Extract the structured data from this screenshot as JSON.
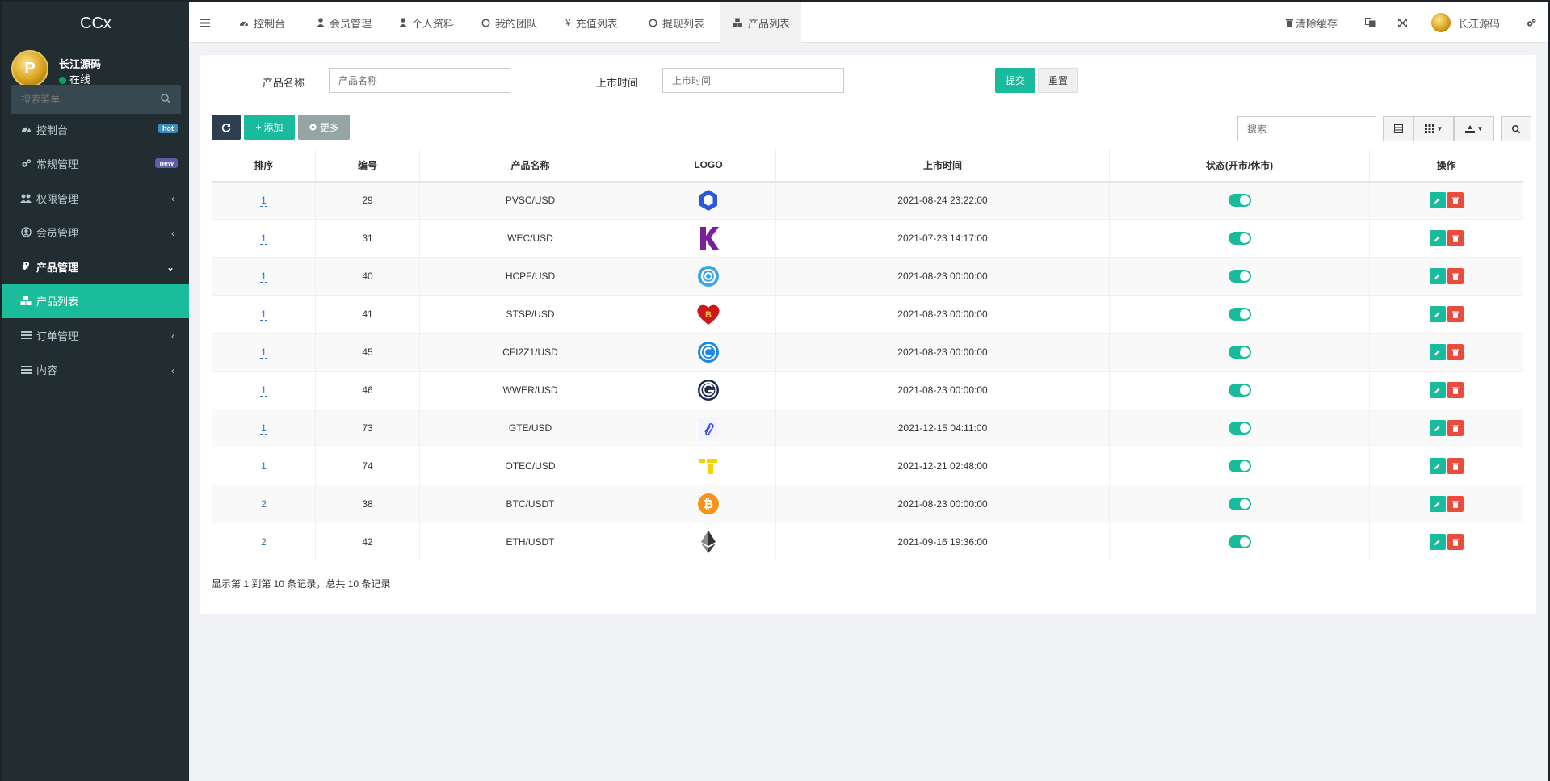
{
  "brand": "CCx",
  "user": {
    "name": "长江源码",
    "status": "在线",
    "avatar_letter": "P"
  },
  "sidebar": {
    "search_placeholder": "搜索菜单",
    "items": [
      {
        "label": "控制台",
        "badge": "hot",
        "badge_color": "#3c8dbc"
      },
      {
        "label": "常规管理",
        "badge": "new",
        "badge_color": "#605ca8"
      },
      {
        "label": "权限管理"
      },
      {
        "label": "会员管理"
      },
      {
        "label": "产品管理"
      },
      {
        "label": "产品列表"
      },
      {
        "label": "订单管理"
      },
      {
        "label": "内容"
      }
    ]
  },
  "topbar": {
    "tabs": [
      "控制台",
      "会员管理",
      "个人资料",
      "我的团队",
      "充值列表",
      "提现列表",
      "产品列表"
    ],
    "clear_cache": "清除缓存",
    "user_name": "长江源码"
  },
  "filter": {
    "name_label": "产品名称",
    "name_placeholder": "产品名称",
    "time_label": "上市时间",
    "time_placeholder": "上市时间",
    "submit": "提交",
    "reset": "重置"
  },
  "toolbar": {
    "add": "添加",
    "more": "更多",
    "search_placeholder": "搜索"
  },
  "table": {
    "headers": [
      "排序",
      "编号",
      "产品名称",
      "LOGO",
      "上市时间",
      "状态(开市/休市)",
      "操作"
    ],
    "rows": [
      {
        "sort": "1",
        "id": "29",
        "name": "PVSC/USD",
        "time": "2021-08-24 23:22:00",
        "logo": "hexagon-logo"
      },
      {
        "sort": "1",
        "id": "31",
        "name": "WEC/USD",
        "time": "2021-07-23 14:17:00",
        "logo": "k-logo"
      },
      {
        "sort": "1",
        "id": "40",
        "name": "HCPF/USD",
        "time": "2021-08-23 00:00:00",
        "logo": "knot-logo"
      },
      {
        "sort": "1",
        "id": "41",
        "name": "STSP/USD",
        "time": "2021-08-23 00:00:00",
        "logo": "heart-logo"
      },
      {
        "sort": "1",
        "id": "45",
        "name": "CFI2Z1/USD",
        "time": "2021-08-23 00:00:00",
        "logo": "circle-c-logo"
      },
      {
        "sort": "1",
        "id": "46",
        "name": "WWER/USD",
        "time": "2021-08-23 00:00:00",
        "logo": "g-logo"
      },
      {
        "sort": "1",
        "id": "73",
        "name": "GTE/USD",
        "time": "2021-12-15 04:11:00",
        "logo": "clip-logo"
      },
      {
        "sort": "1",
        "id": "74",
        "name": "OTEC/USD",
        "time": "2021-12-21 02:48:00",
        "logo": "t-logo"
      },
      {
        "sort": "2",
        "id": "38",
        "name": "BTC/USDT",
        "time": "2021-08-23 00:00:00",
        "logo": "bitcoin-logo"
      },
      {
        "sort": "2",
        "id": "42",
        "name": "ETH/USDT",
        "time": "2021-09-16 19:36:00",
        "logo": "ethereum-logo"
      }
    ]
  },
  "pager": "显示第 1 到第 10 条记录，总共 10 条记录",
  "colors": {
    "accent": "#18bc9c",
    "danger": "#e74c3c",
    "sidebar": "#222d32"
  }
}
